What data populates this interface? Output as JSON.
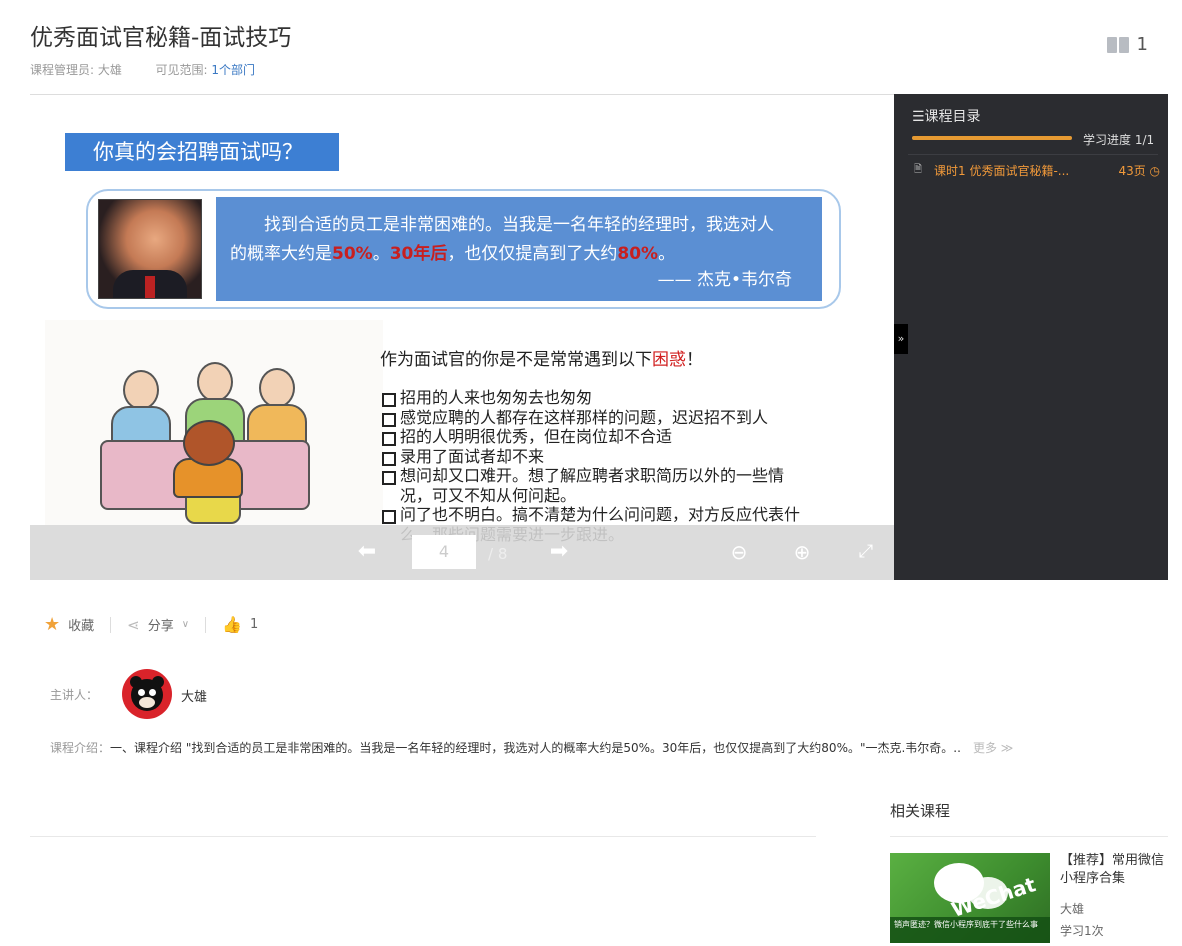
{
  "header": {
    "title": "优秀面试官秘籍-面试技巧",
    "manager_label": "课程管理员:",
    "manager_name": "大雄",
    "scope_label": "可见范围:",
    "scope_value": "1个部门",
    "book_count": "1"
  },
  "slide": {
    "heading": "你真的会招聘面试吗？",
    "quote_line1": "找到合适的员工是非常困难的。当我是一名年轻的经理时，我选对人",
    "quote_line2a": "的概率大约是",
    "quote_pct1": "50%",
    "quote_sep": "。",
    "quote_years": "30年后",
    "quote_line2b": "，也仅仅提高到了大约",
    "quote_pct2": "80%",
    "quote_end": "。",
    "quote_author": "—— 杰克•韦尔奇",
    "confuse_title_a": "作为面试官的你是不是常常遇到以下",
    "confuse_title_red": "困惑",
    "confuse_title_end": "！",
    "confuse_items": [
      "招用的人来也匆匆去也匆匆",
      "感觉应聘的人都存在这样那样的问题，迟迟招不到人",
      "招的人明明很优秀，但在岗位却不合适",
      "录用了面试者却不来",
      "想问却又口难开。想了解应聘者求职简历以外的一些情况，可又不知从何问起。",
      "问了也不明白。搞不清楚为什么问问题，对方反应代表什么，那些问题需要进一步跟进。"
    ]
  },
  "controls": {
    "prev_icon": "arrow-left-icon",
    "page_current": "4",
    "page_total": "/ 8",
    "next_icon": "arrow-right-icon",
    "zoom_out_icon": "zoom-out-icon",
    "zoom_in_icon": "zoom-in-icon",
    "fullscreen_icon": "fullscreen-icon"
  },
  "catalog": {
    "title": "☰课程目录",
    "progress_label": "学习进度 1/1",
    "progress": 1.0,
    "lesson_label": "课时1 优秀面试官秘籍-...",
    "lesson_pages": "43页 ◷",
    "toggle": "»"
  },
  "actions": {
    "favorite": "收藏",
    "share": "分享",
    "like_count": "1"
  },
  "lecturer": {
    "label": "主讲人：",
    "name": "大雄"
  },
  "intro": {
    "label": "课程介绍：",
    "text": "一、课程介绍 \"找到合适的员工是非常困难的。当我是一名年轻的经理时，我选对人的概率大约是50%。30年后，也仅仅提高到了大约80%。\"一杰克.韦尔奇。..",
    "more": "更多 ≫"
  },
  "related": {
    "title": "相关课程",
    "thumb_word": "WeChat",
    "thumb_banner": "销声匿迹？微信小程序到底干了些什么事",
    "name": "【推荐】常用微信小程序合集",
    "author": "大雄",
    "stat": "学习1次"
  },
  "colors": {
    "accent": "#3a78c3",
    "orange": "#f0a23a",
    "panel": "#2b2c30"
  }
}
